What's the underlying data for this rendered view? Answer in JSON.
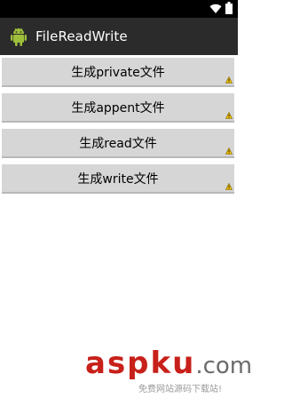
{
  "app": {
    "title": "FileReadWrite"
  },
  "buttons": [
    {
      "label": "生成private文件"
    },
    {
      "label": "生成appent文件"
    },
    {
      "label": "生成read文件"
    },
    {
      "label": "生成write文件"
    }
  ],
  "watermark": {
    "main_prefix": "aspku",
    "main_suffix": ".com",
    "sub": "免费网站源码下载站!"
  },
  "colors": {
    "action_bar": "#2b2b2b",
    "button_bg": "#d6d6d6",
    "watermark_red": "#c8201a",
    "android_green": "#9fbf3b"
  },
  "icons": {
    "status": [
      "wifi-icon",
      "battery-icon"
    ],
    "app": "android-icon",
    "button_badge": "warning-icon"
  }
}
